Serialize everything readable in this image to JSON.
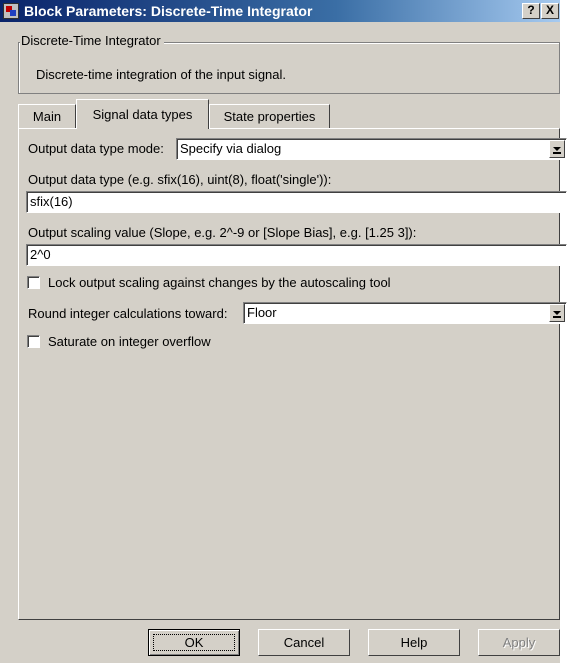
{
  "window": {
    "title": "Block Parameters: Discrete-Time Integrator",
    "help_btn": "?",
    "close_btn": "X"
  },
  "group": {
    "title": "Discrete-Time Integrator",
    "description": "Discrete-time integration of the input signal."
  },
  "tabs": [
    {
      "label": "Main",
      "active": false
    },
    {
      "label": "Signal data types",
      "active": true
    },
    {
      "label": "State properties",
      "active": false
    }
  ],
  "form": {
    "output_mode_label": "Output data type mode:",
    "output_mode_value": "Specify via dialog",
    "output_type_label": "Output data type (e.g. sfix(16), uint(8), float('single')):",
    "output_type_value": "sfix(16)",
    "scaling_label": "Output scaling value (Slope, e.g. 2^-9 or [Slope Bias], e.g. [1.25 3]):",
    "scaling_value": "2^0",
    "lock_label": "Lock output scaling against changes by the autoscaling tool",
    "lock_checked": false,
    "round_label": "Round integer calculations toward:",
    "round_value": "Floor",
    "saturate_label": "Saturate on integer overflow",
    "saturate_checked": false
  },
  "buttons": {
    "ok": "OK",
    "cancel": "Cancel",
    "help": "Help",
    "apply": "Apply"
  }
}
